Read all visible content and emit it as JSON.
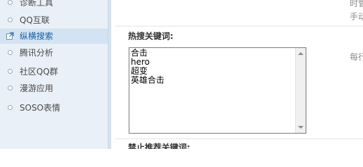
{
  "sidebar": {
    "items": [
      {
        "label": "诊断工具",
        "active": false,
        "icon": "bullet-icon"
      },
      {
        "label": "QQ互联",
        "active": false,
        "icon": "bullet-icon"
      },
      {
        "label": "纵横搜索",
        "active": true,
        "icon": "external-link-icon"
      },
      {
        "label": "腾讯分析",
        "active": false,
        "icon": "bullet-icon"
      },
      {
        "label": "社区QQ群",
        "active": false,
        "icon": "bullet-icon"
      },
      {
        "label": "漫游应用",
        "active": false,
        "icon": "bullet-icon"
      },
      {
        "label": "SOSO表情",
        "active": false,
        "icon": "bullet-icon"
      }
    ]
  },
  "main": {
    "hot_keywords_title": "热搜关键词:",
    "hot_keywords_value": "合击\nhero\n超变\n英雄合击",
    "blocked_keywords_title": "禁止推荐关键词:",
    "right_hints": {
      "top_line1": "时管",
      "top_line2": "手动",
      "mid": "每行"
    }
  },
  "colors": {
    "sidebar_bg": "#e9f0f7",
    "active_item_bg": "#d3e3f3",
    "active_item_text": "#1a5d9c"
  }
}
